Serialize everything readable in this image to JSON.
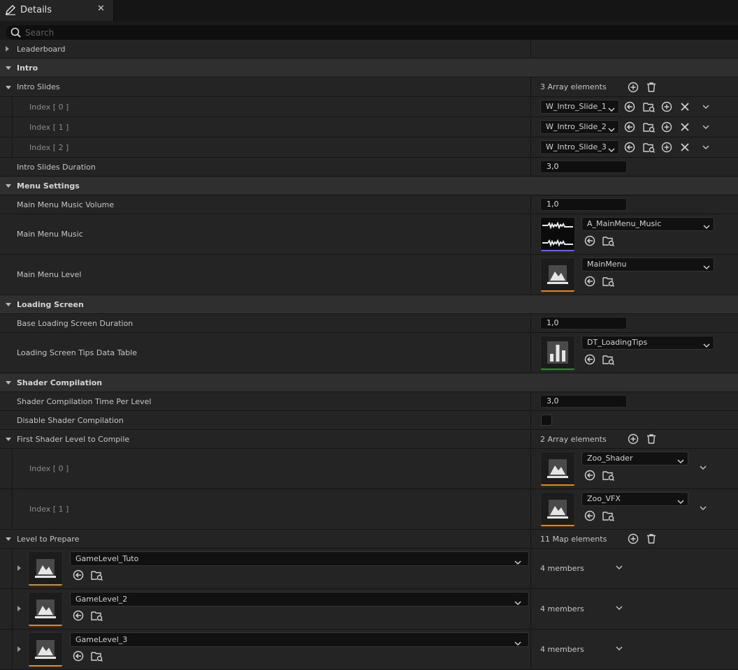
{
  "window": {
    "tab_title": "Details",
    "tab_icon": "pencil-icon",
    "close_icon": "close-icon"
  },
  "search": {
    "placeholder": "Search"
  },
  "colors": {
    "world_asset_bar": "#e08a12",
    "sound_asset_bar": "#6b5cff",
    "data_table_bar": "#2e8b2e",
    "section_header_bg": "#2f2f2f",
    "row_bg": "#242424"
  },
  "sections": {
    "leaderboard": "Leaderboard",
    "intro": "Intro",
    "menu_settings": "Menu Settings",
    "loading_screen": "Loading Screen",
    "shader_compilation": "Shader Compilation"
  },
  "props": {
    "intro_slides": {
      "label": "Intro Slides",
      "count": "3 Array elements"
    },
    "intro_slide_items": [
      {
        "index": "Index [ 0 ]",
        "value": "W_Intro_Slide_1"
      },
      {
        "index": "Index [ 1 ]",
        "value": "W_Intro_Slide_2"
      },
      {
        "index": "Index [ 2 ]",
        "value": "W_Intro_Slide_3"
      }
    ],
    "intro_slides_duration": {
      "label": "Intro Slides Duration",
      "value": "3,0"
    },
    "main_menu_music_volume": {
      "label": "Main Menu Music Volume",
      "value": "1,0"
    },
    "main_menu_music": {
      "label": "Main Menu Music",
      "value": "A_MainMenu_Music",
      "thumb_icon": "waveform-icon"
    },
    "main_menu_level": {
      "label": "Main Menu Level",
      "value": "MainMenu",
      "thumb_icon": "world-icon"
    },
    "base_loading_screen_duration": {
      "label": "Base Loading Screen Duration",
      "value": "1,0"
    },
    "loading_screen_tips": {
      "label": "Loading Screen Tips Data Table",
      "value": "DT_LoadingTips",
      "thumb_icon": "data-table-icon"
    },
    "shader_time_per_level": {
      "label": "Shader Compilation Time Per Level",
      "value": "3,0"
    },
    "disable_shader_compilation": {
      "label": "Disable Shader Compilation",
      "checked": false
    },
    "first_shader_level": {
      "label": "First Shader Level to Compile",
      "count": "2 Array elements"
    },
    "first_shader_items": [
      {
        "index": "Index [ 0 ]",
        "value": "Zoo_Shader"
      },
      {
        "index": "Index [ 1 ]",
        "value": "Zoo_VFX"
      }
    ],
    "level_to_prepare": {
      "label": "Level to Prepare",
      "count": "11 Map elements"
    },
    "level_items": [
      {
        "key": "GameLevel_Tuto",
        "members": "4 members"
      },
      {
        "key": "GameLevel_2",
        "members": "4 members"
      },
      {
        "key": "GameLevel_3",
        "members": "4 members"
      }
    ]
  }
}
